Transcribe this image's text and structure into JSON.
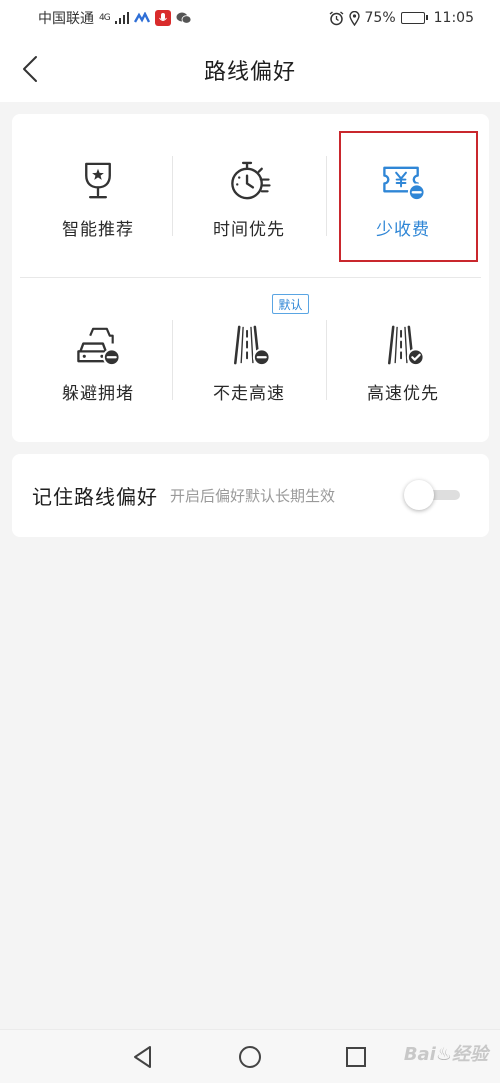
{
  "status_bar": {
    "carrier": "中国联通",
    "network": "4G",
    "battery": "75%",
    "battery_level": 0.75,
    "time": "11:05"
  },
  "header": {
    "title": "路线偏好"
  },
  "options": [
    {
      "label": "智能推荐",
      "icon": "trophy-cup-icon",
      "selected": false
    },
    {
      "label": "时间优先",
      "icon": "stopwatch-icon",
      "selected": false
    },
    {
      "label": "少收费",
      "icon": "toll-ticket-minus-icon",
      "selected": true
    },
    {
      "label": "躲避拥堵",
      "icon": "car-traffic-minus-icon",
      "selected": false
    },
    {
      "label": "不走高速",
      "icon": "highway-minus-icon",
      "selected": false
    },
    {
      "label": "高速优先",
      "icon": "highway-check-icon",
      "selected": false
    }
  ],
  "default_tag": "默认",
  "remember": {
    "title": "记住路线偏好",
    "description": "开启后偏好默认长期生效",
    "enabled": false
  },
  "watermark": "Bai 经验",
  "colors": {
    "accent": "#2f86d6",
    "highlight_border": "#c9272d",
    "background": "#f4f4f4"
  }
}
